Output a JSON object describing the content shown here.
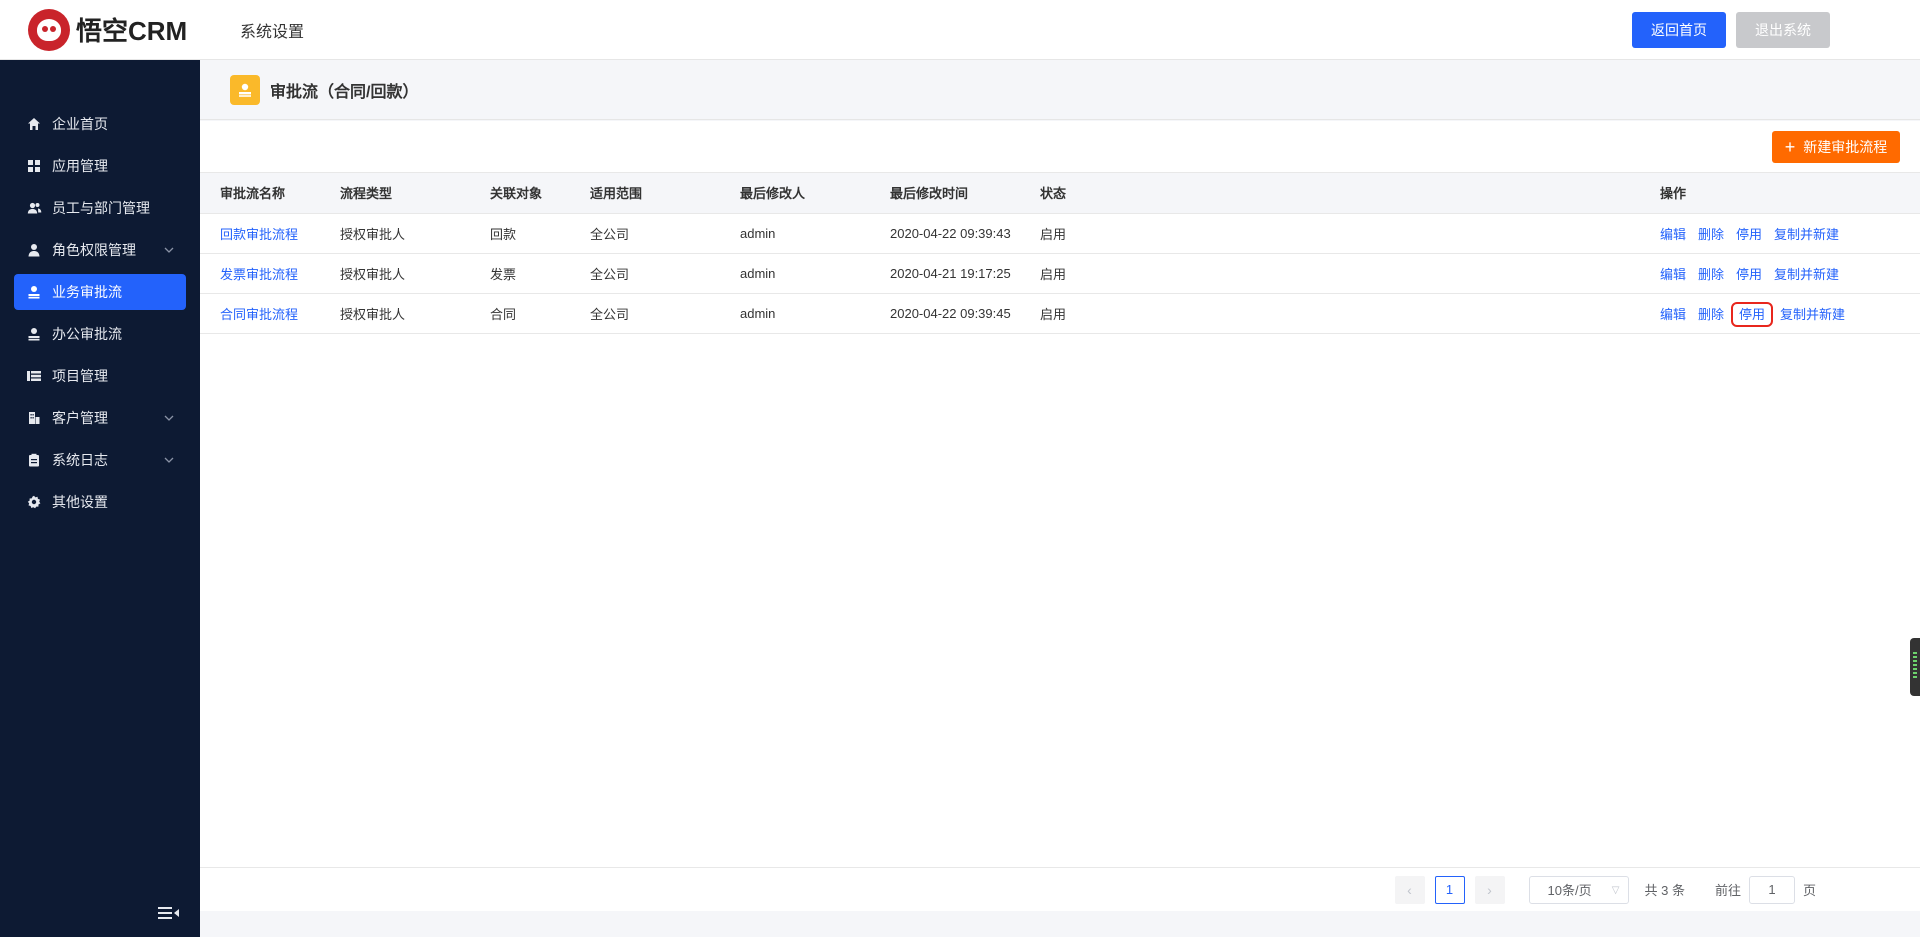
{
  "header": {
    "logo_text": "悟空CRM",
    "section_title": "系统设置",
    "home_button": "返回首页",
    "logout_button": "退出系统"
  },
  "sidebar": {
    "items": [
      {
        "label": "企业首页",
        "icon": "home-icon"
      },
      {
        "label": "应用管理",
        "icon": "grid-icon"
      },
      {
        "label": "员工与部门管理",
        "icon": "users-icon"
      },
      {
        "label": "角色权限管理",
        "icon": "user-icon",
        "has_submenu": true
      },
      {
        "label": "业务审批流",
        "icon": "approval-icon",
        "active": true
      },
      {
        "label": "办公审批流",
        "icon": "approval-icon"
      },
      {
        "label": "项目管理",
        "icon": "project-icon"
      },
      {
        "label": "客户管理",
        "icon": "building-icon",
        "has_submenu": true
      },
      {
        "label": "系统日志",
        "icon": "clipboard-icon",
        "has_submenu": true
      },
      {
        "label": "其他设置",
        "icon": "gear-icon"
      }
    ]
  },
  "page": {
    "title": "审批流（合同/回款）",
    "new_button": "新建审批流程"
  },
  "table": {
    "columns": [
      "审批流名称",
      "流程类型",
      "关联对象",
      "适用范围",
      "最后修改人",
      "最后修改时间",
      "状态",
      "操作"
    ],
    "rows": [
      {
        "name": "回款审批流程",
        "type": "授权审批人",
        "object": "回款",
        "scope": "全公司",
        "modifier": "admin",
        "time": "2020-04-22 09:39:43",
        "status": "启用"
      },
      {
        "name": "发票审批流程",
        "type": "授权审批人",
        "object": "发票",
        "scope": "全公司",
        "modifier": "admin",
        "time": "2020-04-21 19:17:25",
        "status": "启用"
      },
      {
        "name": "合同审批流程",
        "type": "授权审批人",
        "object": "合同",
        "scope": "全公司",
        "modifier": "admin",
        "time": "2020-04-22 09:39:45",
        "status": "启用"
      }
    ],
    "ops": {
      "edit": "编辑",
      "delete": "删除",
      "disable": "停用",
      "copy": "复制并新建"
    }
  },
  "pagination": {
    "current_page": "1",
    "page_size": "10条/页",
    "total": "共 3 条",
    "goto_label": "前往",
    "goto_value": "1",
    "page_suffix": "页"
  },
  "colors": {
    "primary": "#2362fb",
    "sidebar_bg": "#0d1a33",
    "orange": "#ff6a00",
    "highlight": "#e8261c"
  }
}
